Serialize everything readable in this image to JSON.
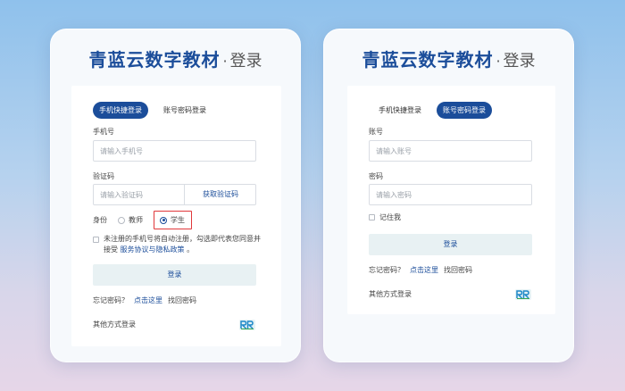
{
  "brand": {
    "name": "青蓝云数字教材",
    "dot": "·",
    "suffix": "登录"
  },
  "left": {
    "tabs": [
      {
        "label": "手机快捷登录",
        "active": true
      },
      {
        "label": "账号密码登录",
        "active": false
      }
    ],
    "phone_label": "手机号",
    "phone_placeholder": "请输入手机号",
    "code_label": "验证码",
    "code_placeholder": "请输入验证码",
    "get_code": "获取验证码",
    "identity_label": "身份",
    "identity_options": [
      {
        "label": "教师",
        "checked": false
      },
      {
        "label": "学生",
        "checked": true
      }
    ],
    "agree_text_1": "未注册的手机号将自动注册，勾选即代表您同意并接受",
    "agree_link": "服务协议与隐私政策",
    "agree_text_2": "。",
    "submit": "登录",
    "forgot_q": "忘记密码？",
    "forgot_link": "点击这里",
    "forgot_action": "找回密码",
    "other": "其他方式登录"
  },
  "right": {
    "tabs": [
      {
        "label": "手机快捷登录",
        "active": false
      },
      {
        "label": "账号密码登录",
        "active": true
      }
    ],
    "account_label": "账号",
    "account_placeholder": "请输入账号",
    "password_label": "密码",
    "password_placeholder": "请输入密码",
    "remember": "记住我",
    "submit": "登录",
    "forgot_q": "忘记密码？",
    "forgot_link": "点击这里",
    "forgot_action": "找回密码",
    "other": "其他方式登录"
  },
  "colors": {
    "accent": "#1b4d9a",
    "highlight": "#e0373a",
    "button_bg": "#e8f1f3"
  },
  "icons": {
    "third_party": "rr-logo-icon"
  }
}
